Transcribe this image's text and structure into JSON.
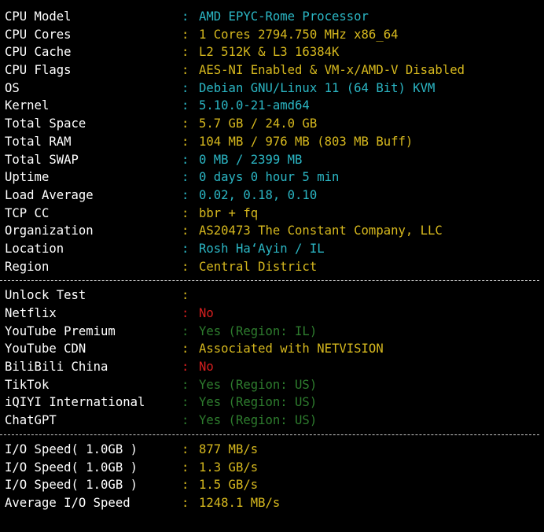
{
  "colors": {
    "background": "#000000",
    "label": "#ffffff",
    "cyan": "#2bb6c4",
    "yellow": "#d6b81e",
    "red": "#d71f1f",
    "green": "#2e7d2e",
    "separator": "#c8c8c8"
  },
  "system_info": [
    {
      "key": "CPU Model",
      "value": "AMD EPYC-Rome Processor",
      "color": "cyan"
    },
    {
      "key": "CPU Cores",
      "value": "1 Cores 2794.750 MHz x86_64",
      "color": "yellow"
    },
    {
      "key": "CPU Cache",
      "value": "L2 512K & L3 16384K",
      "color": "yellow"
    },
    {
      "key": "CPU Flags",
      "value": "AES-NI Enabled & VM-x/AMD-V Disabled",
      "color": "yellow"
    },
    {
      "key": "OS",
      "value": "Debian GNU/Linux 11 (64 Bit) KVM",
      "color": "cyan"
    },
    {
      "key": "Kernel",
      "value": "5.10.0-21-amd64",
      "color": "cyan"
    },
    {
      "key": "Total Space",
      "value": "5.7 GB / 24.0 GB",
      "color": "yellow"
    },
    {
      "key": "Total RAM",
      "value": "104 MB / 976 MB (803 MB Buff)",
      "color": "yellow"
    },
    {
      "key": "Total SWAP",
      "value": "0 MB / 2399 MB",
      "color": "cyan"
    },
    {
      "key": "Uptime",
      "value": "0 days 0 hour 5 min",
      "color": "cyan"
    },
    {
      "key": "Load Average",
      "value": "0.02, 0.18, 0.10",
      "color": "cyan"
    },
    {
      "key": "TCP CC",
      "value": "bbr + fq",
      "color": "yellow"
    },
    {
      "key": "Organization",
      "value": "AS20473 The Constant Company, LLC",
      "color": "yellow"
    },
    {
      "key": "Location",
      "value": "Rosh Ha‘Ayin / IL",
      "color": "cyan"
    },
    {
      "key": "Region",
      "value": "Central District",
      "color": "yellow"
    }
  ],
  "unlock_test": [
    {
      "key": "Unlock Test",
      "value": "",
      "color": "yellow"
    },
    {
      "key": "Netflix",
      "value": "No",
      "color": "red"
    },
    {
      "key": "YouTube Premium",
      "value": "Yes (Region: IL)",
      "color": "green"
    },
    {
      "key": "YouTube CDN",
      "value": "Associated with NETVISION",
      "color": "yellow"
    },
    {
      "key": "BiliBili China",
      "value": "No",
      "color": "red"
    },
    {
      "key": "TikTok",
      "value": "Yes (Region: US)",
      "color": "green"
    },
    {
      "key": "iQIYI International",
      "value": "Yes (Region: US)",
      "color": "green"
    },
    {
      "key": "ChatGPT",
      "value": "Yes (Region: US)",
      "color": "green"
    }
  ],
  "io_speed": [
    {
      "key": "I/O Speed( 1.0GB )",
      "value": "877 MB/s",
      "color": "yellow"
    },
    {
      "key": "I/O Speed( 1.0GB )",
      "value": "1.3 GB/s",
      "color": "yellow"
    },
    {
      "key": "I/O Speed( 1.0GB )",
      "value": "1.5 GB/s",
      "color": "yellow"
    },
    {
      "key": "Average I/O Speed",
      "value": "1248.1 MB/s",
      "color": "yellow"
    }
  ],
  "separator_char": ":"
}
